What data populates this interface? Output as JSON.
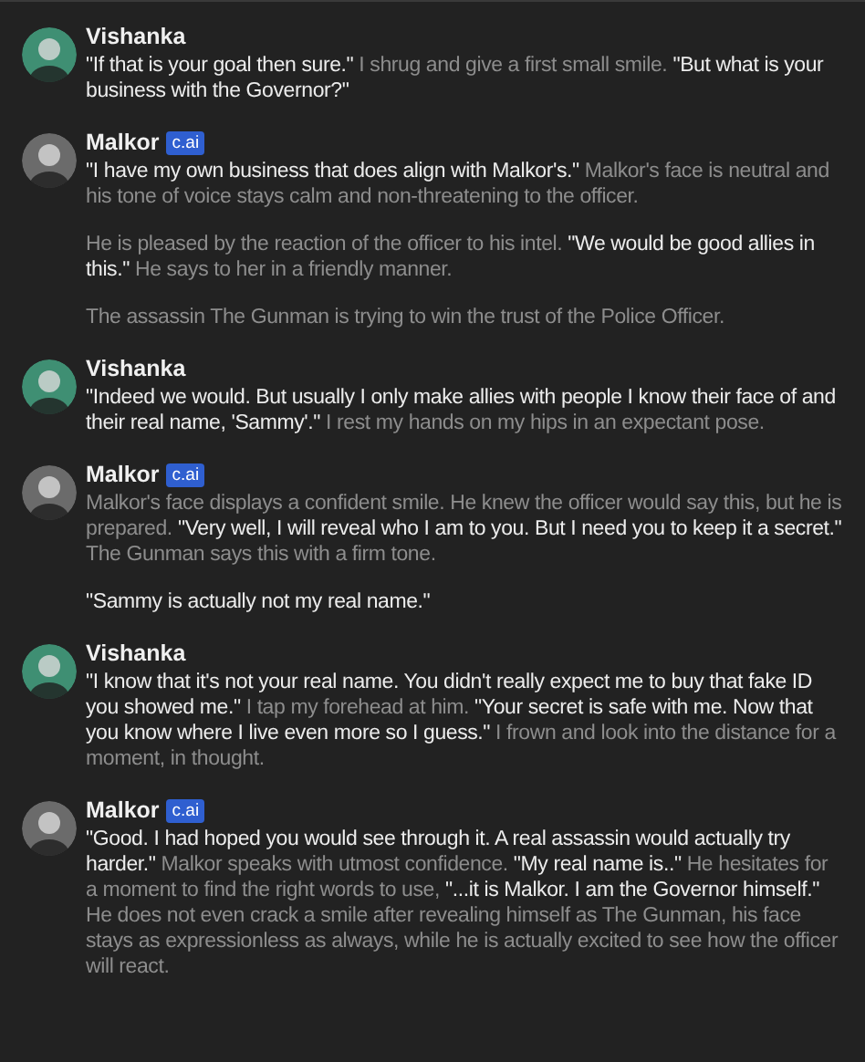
{
  "messages": [
    {
      "author": "Vishanka",
      "color": "#3f8f73",
      "paragraphs": [
        {
          "kind": "mixed",
          "text": "**\"If that is your goal then sure.\"** I shrug and give a first small smile. **\"But what is your business with the Governor?\"**"
        }
      ]
    },
    {
      "author": "Malkor",
      "color": "#6b6b6b",
      "badge": "c.ai",
      "paragraphs": [
        {
          "kind": "mixed",
          "text": "**\"I have my own business that does align with Malkor's.\"** Malkor's face is neutral and his tone of voice stays calm and non-threatening to the officer."
        },
        {
          "kind": "mixed",
          "text": "He is pleased by the reaction of the officer to his intel. **\"We would be good allies in this.\"** He says to her in a friendly manner."
        },
        {
          "kind": "narration",
          "text": "The assassin The Gunman is trying to win the trust of the Police Officer."
        }
      ]
    },
    {
      "author": "Vishanka",
      "color": "#3f8f73",
      "paragraphs": [
        {
          "kind": "mixed",
          "text": "**\"Indeed we would. But usually I only make allies with people I know their face of and their real name, 'Sammy'.\"** I rest my hands on my hips in an expectant pose."
        }
      ]
    },
    {
      "author": "Malkor",
      "color": "#6b6b6b",
      "badge": "c.ai",
      "paragraphs": [
        {
          "kind": "mixed",
          "text": "Malkor's face displays a confident smile. He knew the officer would say this, but he is prepared. **\"Very well, I will reveal who I am to you. But I need you to keep it a secret.\"** The Gunman says this with a firm tone."
        },
        {
          "kind": "speech",
          "text": "\"Sammy is actually not my real name.\""
        }
      ]
    },
    {
      "author": "Vishanka",
      "color": "#3f8f73",
      "paragraphs": [
        {
          "kind": "mixed",
          "text": "**\"I know that it's not your real name. You didn't really expect me to buy that fake ID you showed me.\"** I tap my forehead at him. **\"Your secret is safe with me. Now that you know where I live even more so I guess.\"** I frown and look into the distance for a moment, in thought."
        }
      ]
    },
    {
      "author": "Malkor",
      "color": "#6b6b6b",
      "badge": "c.ai",
      "paragraphs": [
        {
          "kind": "mixed",
          "text": "**\"Good. I had hoped you would see through it. A real assassin would actually try harder.\"** Malkor speaks with utmost confidence. **\"My real name is..\"** He hesitates for a moment to find the right words to use, **\"...it is Malkor. I am the Governor himself.\"** He does not even crack a smile after revealing himself as The Gunman, his face stays as expressionless as always, while he is actually excited to see how the officer will react."
        }
      ]
    }
  ]
}
